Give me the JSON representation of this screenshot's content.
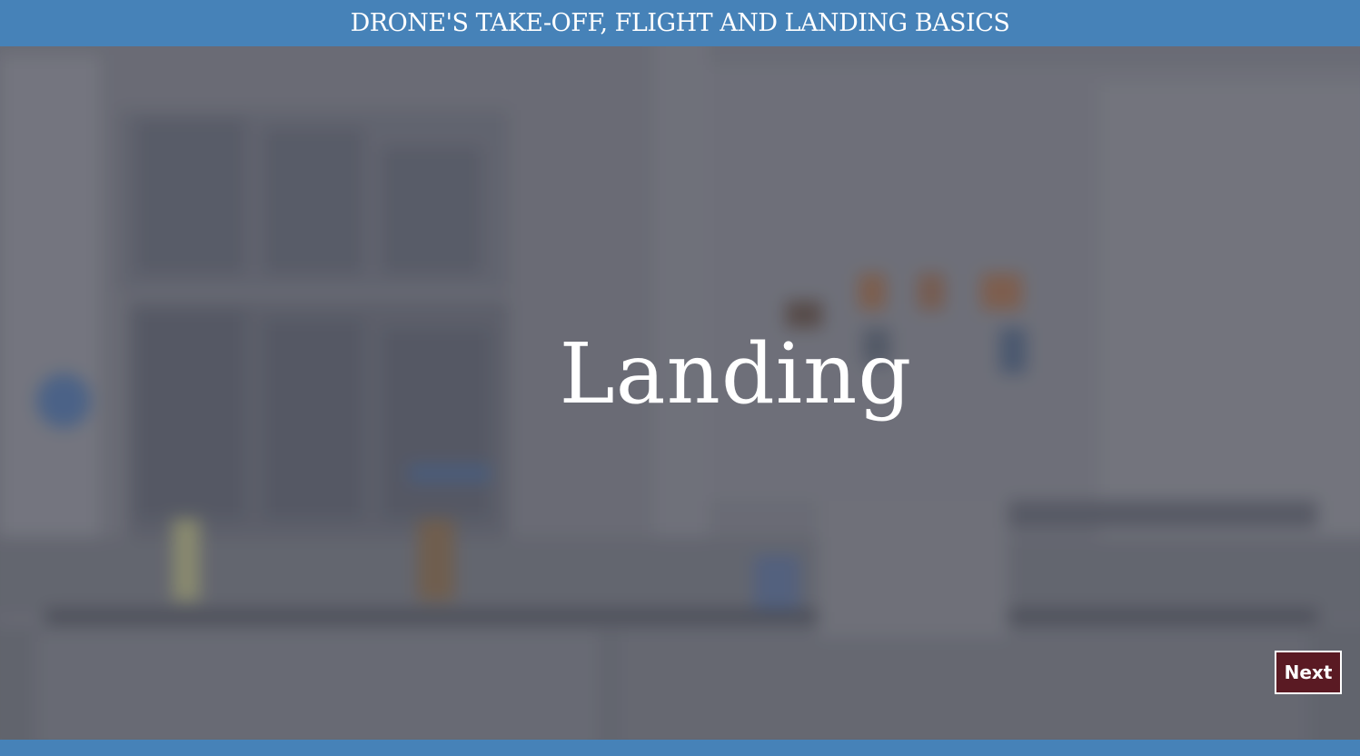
{
  "header": {
    "title": "DRONE'S TAKE-OFF, FLIGHT AND LANDING BASICS"
  },
  "slide": {
    "title": "Landing"
  },
  "navigation": {
    "next_label": "Next"
  },
  "colors": {
    "header_bar": "#4682b8",
    "footer_bar": "#4682b8",
    "next_button_bg": "#5a1a23",
    "next_button_border": "#ffffff",
    "title_text": "#ffffff"
  }
}
